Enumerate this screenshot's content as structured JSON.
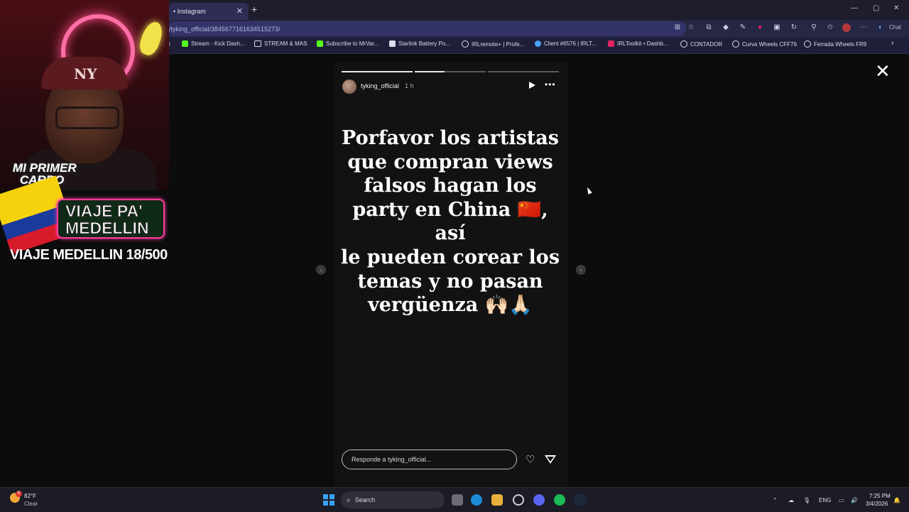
{
  "browser": {
    "tab_title": "• Instagram",
    "new_tab": "+",
    "close_tab": "✕",
    "address": "/tyking_official/3845677161634515273/",
    "window_controls": [
      "—",
      "▢",
      "✕"
    ],
    "copilot_label": "Chat",
    "bookmarks": [
      {
        "label": "Stream - Kick Dash...",
        "icon": "kick-icon",
        "color": "#53fc18"
      },
      {
        "label": "STREAM & MAS",
        "icon": "folder-icon",
        "color": "#dcdcec"
      },
      {
        "label": "Subscribe to MrVar...",
        "icon": "kick-icon",
        "color": "#53fc18"
      },
      {
        "label": "Starlink Battery Po...",
        "icon": "page-icon",
        "color": "#dcdcec"
      },
      {
        "label": "IRLremote+ | Profe...",
        "icon": "globe-icon",
        "color": "#dcdcec"
      },
      {
        "label": "Client #6576 | IRLT...",
        "icon": "cloud-icon",
        "color": "#4aa3ff"
      },
      {
        "label": "IRLToolkit • Dashb...",
        "icon": "irltoolkit-icon",
        "color": "#e0245e"
      },
      {
        "label": "CONTADOR",
        "icon": "counter-icon",
        "color": "#dcdcec"
      },
      {
        "label": "Curva Wheels CFF76",
        "icon": "wheel-icon",
        "color": "#dcdcec"
      },
      {
        "label": "Ferrada Wheels FR9",
        "icon": "wheel-icon",
        "color": "#dcdcec"
      }
    ],
    "bookmarks_overflow": "›"
  },
  "story": {
    "username": "tyking_official",
    "time_ago": "1 h",
    "progress": [
      1,
      0.4,
      0,
      0
    ],
    "text_lines": [
      "Porfavor los artistas",
      "que compran views",
      "falsos hagan los",
      "party en China 🇨🇳, así",
      "le pueden corear los",
      "temas y no pasan",
      "vergüenza 🙌🏻🙏🏻"
    ],
    "reply_placeholder": "Responde a tyking_official...",
    "close_symbol": "✕",
    "more_symbol": "•••",
    "prev_symbol": "‹",
    "next_symbol": "›"
  },
  "overlay": {
    "cap_logo": "NY",
    "car_badge_line1": "MI PRIMER",
    "car_badge_line2": "CARRO",
    "trip_line1": "VIAJE PA'",
    "trip_line2": "MEDELLIN",
    "goal_text": "VIAJE MEDELLIN 18/500"
  },
  "taskbar": {
    "weather_temp": "82°F",
    "weather_desc": "Clear",
    "search_label": "Search",
    "language": "ENG",
    "time": "7:25 PM",
    "date": "3/4/2026",
    "notification_badge": "6"
  },
  "colors": {
    "accent_tab": "#2d2d55",
    "taskbar_bg": "#1c1c26",
    "story_bg": "#121212",
    "neon_pink": "#ff6ea6"
  }
}
